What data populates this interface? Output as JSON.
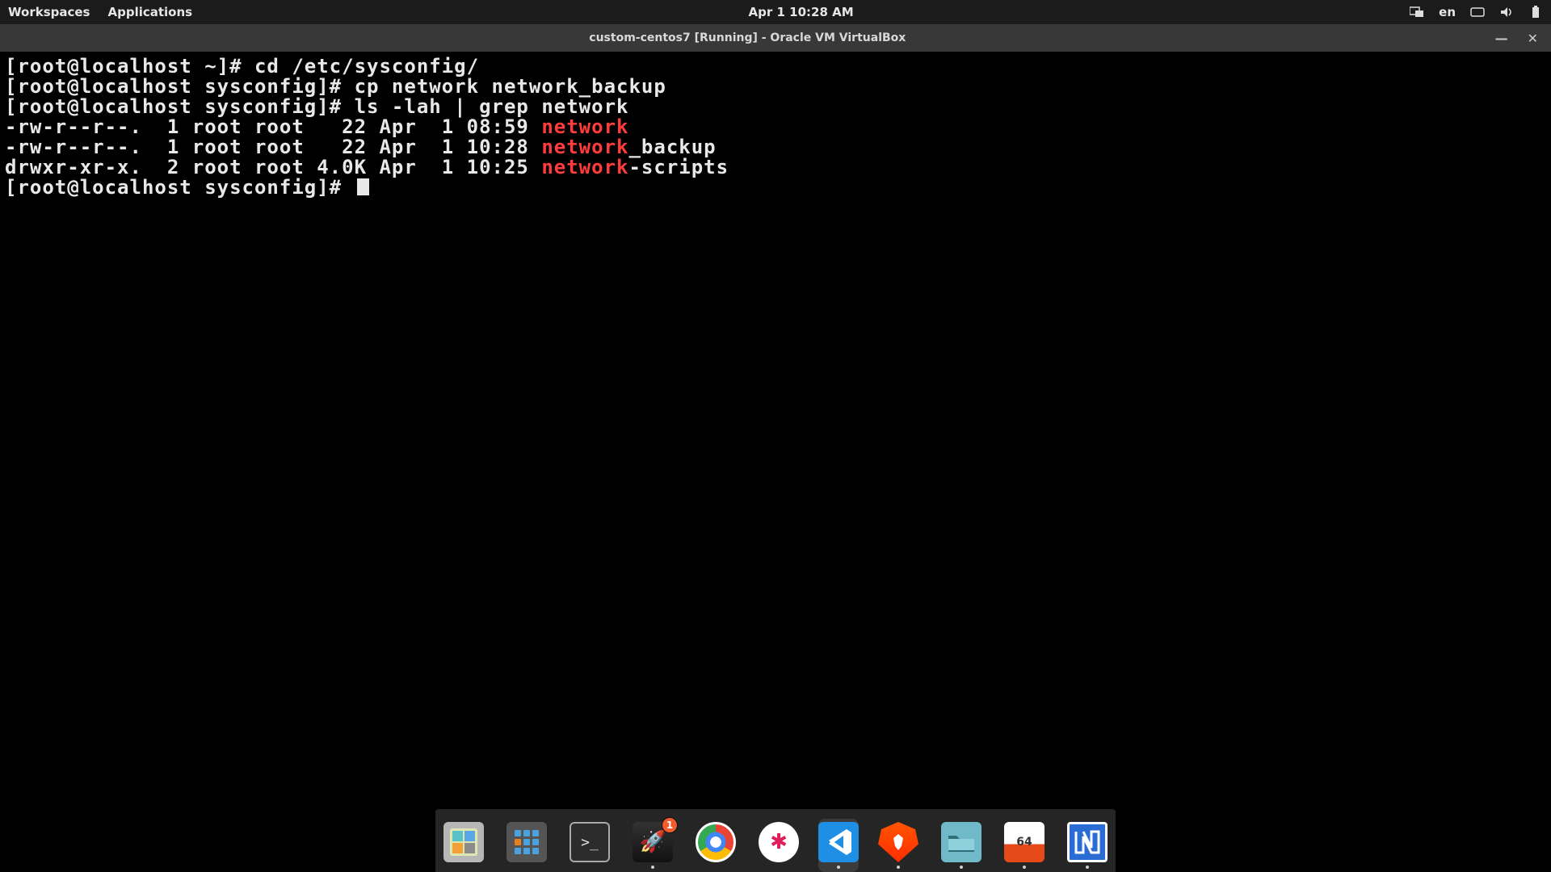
{
  "panel": {
    "workspaces": "Workspaces",
    "applications": "Applications",
    "clock": "Apr 1  10:28 AM",
    "input_lang": "en"
  },
  "window": {
    "title": "custom-centos7 [Running] - Oracle VM VirtualBox"
  },
  "terminal": {
    "lines": [
      {
        "segments": [
          {
            "t": "[root@localhost ~]# cd /etc/sysconfig/"
          }
        ]
      },
      {
        "segments": [
          {
            "t": "[root@localhost sysconfig]# cp network network_backup"
          }
        ]
      },
      {
        "segments": [
          {
            "t": "[root@localhost sysconfig]# ls -lah | grep network"
          }
        ]
      },
      {
        "segments": [
          {
            "t": "-rw-r--r--.  1 root root   22 Apr  1 08:59 "
          },
          {
            "t": "network",
            "hl": true
          }
        ]
      },
      {
        "segments": [
          {
            "t": "-rw-r--r--.  1 root root   22 Apr  1 10:28 "
          },
          {
            "t": "network",
            "hl": true
          },
          {
            "t": "_backup"
          }
        ]
      },
      {
        "segments": [
          {
            "t": "drwxr-xr-x.  2 root root 4.0K Apr  1 10:25 "
          },
          {
            "t": "network",
            "hl": true
          },
          {
            "t": "-scripts"
          }
        ]
      },
      {
        "segments": [
          {
            "t": "[root@localhost sysconfig]# "
          }
        ],
        "cursor": true
      }
    ]
  },
  "dock": {
    "items": [
      {
        "id": "files-manager",
        "cls": "ico-files",
        "glyph": "",
        "running": false
      },
      {
        "id": "show-apps",
        "cls": "ico-apps",
        "glyph": "",
        "running": false
      },
      {
        "id": "terminal-app",
        "cls": "ico-terminal",
        "glyph": ">_",
        "running": false
      },
      {
        "id": "launcher-app",
        "cls": "ico-rocket",
        "glyph": "🚀",
        "running": true,
        "badge": "1"
      },
      {
        "id": "chrome-browser",
        "cls": "ico-chrome",
        "glyph": "",
        "running": false
      },
      {
        "id": "slack-app",
        "cls": "ico-slack",
        "glyph": "✱",
        "running": false
      },
      {
        "id": "vscode-app",
        "cls": "ico-vscode",
        "glyph": "⟨⟩",
        "running": true,
        "active": true
      },
      {
        "id": "brave-browser",
        "cls": "ico-brave",
        "glyph": "",
        "running": true
      },
      {
        "id": "file-manager-2",
        "cls": "ico-folder",
        "glyph": "",
        "running": true
      },
      {
        "id": "calendar-app",
        "cls": "ico-cal",
        "glyph": "64",
        "running": true
      },
      {
        "id": "virtualbox-app",
        "cls": "ico-vbox",
        "glyph": "",
        "running": true
      }
    ]
  }
}
